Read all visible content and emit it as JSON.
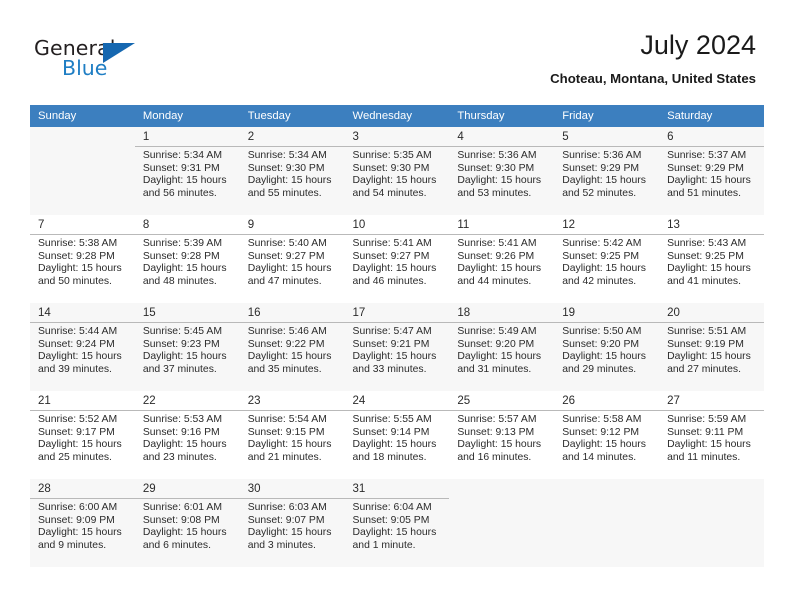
{
  "brand": {
    "name_dark": "General",
    "name_blue": "Blue",
    "dark_color": "#231f20",
    "blue_color": "#1f7ec4",
    "triangle_color": "#1567b0"
  },
  "header": {
    "title": "July 2024",
    "subtitle": "Choteau, Montana, United States"
  },
  "theme": {
    "header_row_bg": "#3c7fbf",
    "header_row_text": "#ffffff",
    "row_alt_bg": "#f7f7f7",
    "row_bg": "#ffffff",
    "cell_rule": "#b9b9b9"
  },
  "weekdays": [
    "Sunday",
    "Monday",
    "Tuesday",
    "Wednesday",
    "Thursday",
    "Friday",
    "Saturday"
  ],
  "calendar": {
    "month": "July",
    "year": "2024",
    "weeks": [
      [
        {
          "day": "",
          "sunrise": "",
          "sunset": "",
          "daylight1": "",
          "daylight2": ""
        },
        {
          "day": "1",
          "sunrise": "Sunrise: 5:34 AM",
          "sunset": "Sunset: 9:31 PM",
          "daylight1": "Daylight: 15 hours",
          "daylight2": "and 56 minutes."
        },
        {
          "day": "2",
          "sunrise": "Sunrise: 5:34 AM",
          "sunset": "Sunset: 9:30 PM",
          "daylight1": "Daylight: 15 hours",
          "daylight2": "and 55 minutes."
        },
        {
          "day": "3",
          "sunrise": "Sunrise: 5:35 AM",
          "sunset": "Sunset: 9:30 PM",
          "daylight1": "Daylight: 15 hours",
          "daylight2": "and 54 minutes."
        },
        {
          "day": "4",
          "sunrise": "Sunrise: 5:36 AM",
          "sunset": "Sunset: 9:30 PM",
          "daylight1": "Daylight: 15 hours",
          "daylight2": "and 53 minutes."
        },
        {
          "day": "5",
          "sunrise": "Sunrise: 5:36 AM",
          "sunset": "Sunset: 9:29 PM",
          "daylight1": "Daylight: 15 hours",
          "daylight2": "and 52 minutes."
        },
        {
          "day": "6",
          "sunrise": "Sunrise: 5:37 AM",
          "sunset": "Sunset: 9:29 PM",
          "daylight1": "Daylight: 15 hours",
          "daylight2": "and 51 minutes."
        }
      ],
      [
        {
          "day": "7",
          "sunrise": "Sunrise: 5:38 AM",
          "sunset": "Sunset: 9:28 PM",
          "daylight1": "Daylight: 15 hours",
          "daylight2": "and 50 minutes."
        },
        {
          "day": "8",
          "sunrise": "Sunrise: 5:39 AM",
          "sunset": "Sunset: 9:28 PM",
          "daylight1": "Daylight: 15 hours",
          "daylight2": "and 48 minutes."
        },
        {
          "day": "9",
          "sunrise": "Sunrise: 5:40 AM",
          "sunset": "Sunset: 9:27 PM",
          "daylight1": "Daylight: 15 hours",
          "daylight2": "and 47 minutes."
        },
        {
          "day": "10",
          "sunrise": "Sunrise: 5:41 AM",
          "sunset": "Sunset: 9:27 PM",
          "daylight1": "Daylight: 15 hours",
          "daylight2": "and 46 minutes."
        },
        {
          "day": "11",
          "sunrise": "Sunrise: 5:41 AM",
          "sunset": "Sunset: 9:26 PM",
          "daylight1": "Daylight: 15 hours",
          "daylight2": "and 44 minutes."
        },
        {
          "day": "12",
          "sunrise": "Sunrise: 5:42 AM",
          "sunset": "Sunset: 9:25 PM",
          "daylight1": "Daylight: 15 hours",
          "daylight2": "and 42 minutes."
        },
        {
          "day": "13",
          "sunrise": "Sunrise: 5:43 AM",
          "sunset": "Sunset: 9:25 PM",
          "daylight1": "Daylight: 15 hours",
          "daylight2": "and 41 minutes."
        }
      ],
      [
        {
          "day": "14",
          "sunrise": "Sunrise: 5:44 AM",
          "sunset": "Sunset: 9:24 PM",
          "daylight1": "Daylight: 15 hours",
          "daylight2": "and 39 minutes."
        },
        {
          "day": "15",
          "sunrise": "Sunrise: 5:45 AM",
          "sunset": "Sunset: 9:23 PM",
          "daylight1": "Daylight: 15 hours",
          "daylight2": "and 37 minutes."
        },
        {
          "day": "16",
          "sunrise": "Sunrise: 5:46 AM",
          "sunset": "Sunset: 9:22 PM",
          "daylight1": "Daylight: 15 hours",
          "daylight2": "and 35 minutes."
        },
        {
          "day": "17",
          "sunrise": "Sunrise: 5:47 AM",
          "sunset": "Sunset: 9:21 PM",
          "daylight1": "Daylight: 15 hours",
          "daylight2": "and 33 minutes."
        },
        {
          "day": "18",
          "sunrise": "Sunrise: 5:49 AM",
          "sunset": "Sunset: 9:20 PM",
          "daylight1": "Daylight: 15 hours",
          "daylight2": "and 31 minutes."
        },
        {
          "day": "19",
          "sunrise": "Sunrise: 5:50 AM",
          "sunset": "Sunset: 9:20 PM",
          "daylight1": "Daylight: 15 hours",
          "daylight2": "and 29 minutes."
        },
        {
          "day": "20",
          "sunrise": "Sunrise: 5:51 AM",
          "sunset": "Sunset: 9:19 PM",
          "daylight1": "Daylight: 15 hours",
          "daylight2": "and 27 minutes."
        }
      ],
      [
        {
          "day": "21",
          "sunrise": "Sunrise: 5:52 AM",
          "sunset": "Sunset: 9:17 PM",
          "daylight1": "Daylight: 15 hours",
          "daylight2": "and 25 minutes."
        },
        {
          "day": "22",
          "sunrise": "Sunrise: 5:53 AM",
          "sunset": "Sunset: 9:16 PM",
          "daylight1": "Daylight: 15 hours",
          "daylight2": "and 23 minutes."
        },
        {
          "day": "23",
          "sunrise": "Sunrise: 5:54 AM",
          "sunset": "Sunset: 9:15 PM",
          "daylight1": "Daylight: 15 hours",
          "daylight2": "and 21 minutes."
        },
        {
          "day": "24",
          "sunrise": "Sunrise: 5:55 AM",
          "sunset": "Sunset: 9:14 PM",
          "daylight1": "Daylight: 15 hours",
          "daylight2": "and 18 minutes."
        },
        {
          "day": "25",
          "sunrise": "Sunrise: 5:57 AM",
          "sunset": "Sunset: 9:13 PM",
          "daylight1": "Daylight: 15 hours",
          "daylight2": "and 16 minutes."
        },
        {
          "day": "26",
          "sunrise": "Sunrise: 5:58 AM",
          "sunset": "Sunset: 9:12 PM",
          "daylight1": "Daylight: 15 hours",
          "daylight2": "and 14 minutes."
        },
        {
          "day": "27",
          "sunrise": "Sunrise: 5:59 AM",
          "sunset": "Sunset: 9:11 PM",
          "daylight1": "Daylight: 15 hours",
          "daylight2": "and 11 minutes."
        }
      ],
      [
        {
          "day": "28",
          "sunrise": "Sunrise: 6:00 AM",
          "sunset": "Sunset: 9:09 PM",
          "daylight1": "Daylight: 15 hours",
          "daylight2": "and 9 minutes."
        },
        {
          "day": "29",
          "sunrise": "Sunrise: 6:01 AM",
          "sunset": "Sunset: 9:08 PM",
          "daylight1": "Daylight: 15 hours",
          "daylight2": "and 6 minutes."
        },
        {
          "day": "30",
          "sunrise": "Sunrise: 6:03 AM",
          "sunset": "Sunset: 9:07 PM",
          "daylight1": "Daylight: 15 hours",
          "daylight2": "and 3 minutes."
        },
        {
          "day": "31",
          "sunrise": "Sunrise: 6:04 AM",
          "sunset": "Sunset: 9:05 PM",
          "daylight1": "Daylight: 15 hours",
          "daylight2": "and 1 minute."
        },
        {
          "day": "",
          "sunrise": "",
          "sunset": "",
          "daylight1": "",
          "daylight2": ""
        },
        {
          "day": "",
          "sunrise": "",
          "sunset": "",
          "daylight1": "",
          "daylight2": ""
        },
        {
          "day": "",
          "sunrise": "",
          "sunset": "",
          "daylight1": "",
          "daylight2": ""
        }
      ]
    ]
  }
}
